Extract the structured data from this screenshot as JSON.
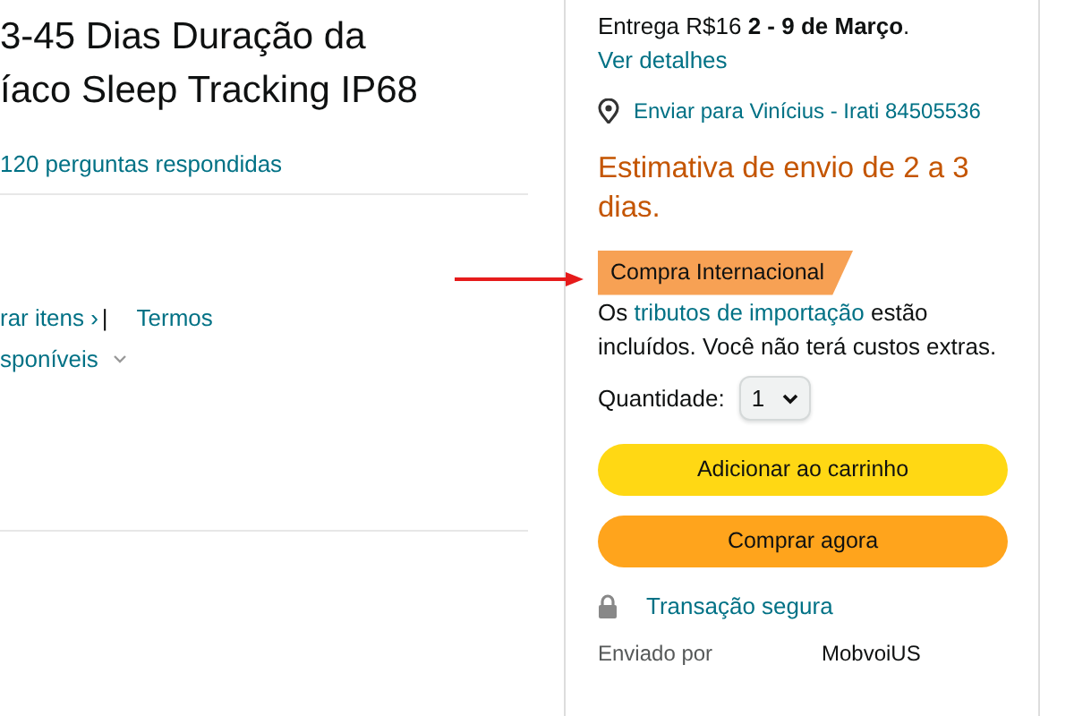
{
  "product": {
    "title_lines": [
      "3-45 Dias Duração da",
      "íaco Sleep Tracking IP68"
    ],
    "answered_questions": "120 perguntas respondidas",
    "links": [
      {
        "kind": "link",
        "text": "rar itens ›"
      },
      {
        "kind": "separator",
        "text": "|"
      },
      {
        "kind": "link",
        "text": "Termos"
      }
    ],
    "available": "sponíveis"
  },
  "buy_box": {
    "delivery": {
      "prefix": "Entrega R$16 **2 - 9 de Março**.",
      "link": "Ver detalhes"
    },
    "ship_to": "Enviar para Vinícius - Irati 84505536",
    "estimate": "Estimativa de envio de 2 a 3 dias.",
    "badge": "Compra Internacional",
    "import_note": {
      "before": "Os",
      "link": "tributos de importação",
      "after": "estão incluídos. Você não terá custos extras."
    },
    "quantity": {
      "label": "Quantidade:",
      "value": "1"
    },
    "buttons": [
      {
        "kind": "cart",
        "label": "Adicionar ao carrinho"
      },
      {
        "kind": "buy",
        "label": "Comprar agora"
      }
    ],
    "secure": "Transação segura",
    "seller_row": {
      "label": "Enviado por",
      "value": "MobvoiUS"
    }
  }
}
